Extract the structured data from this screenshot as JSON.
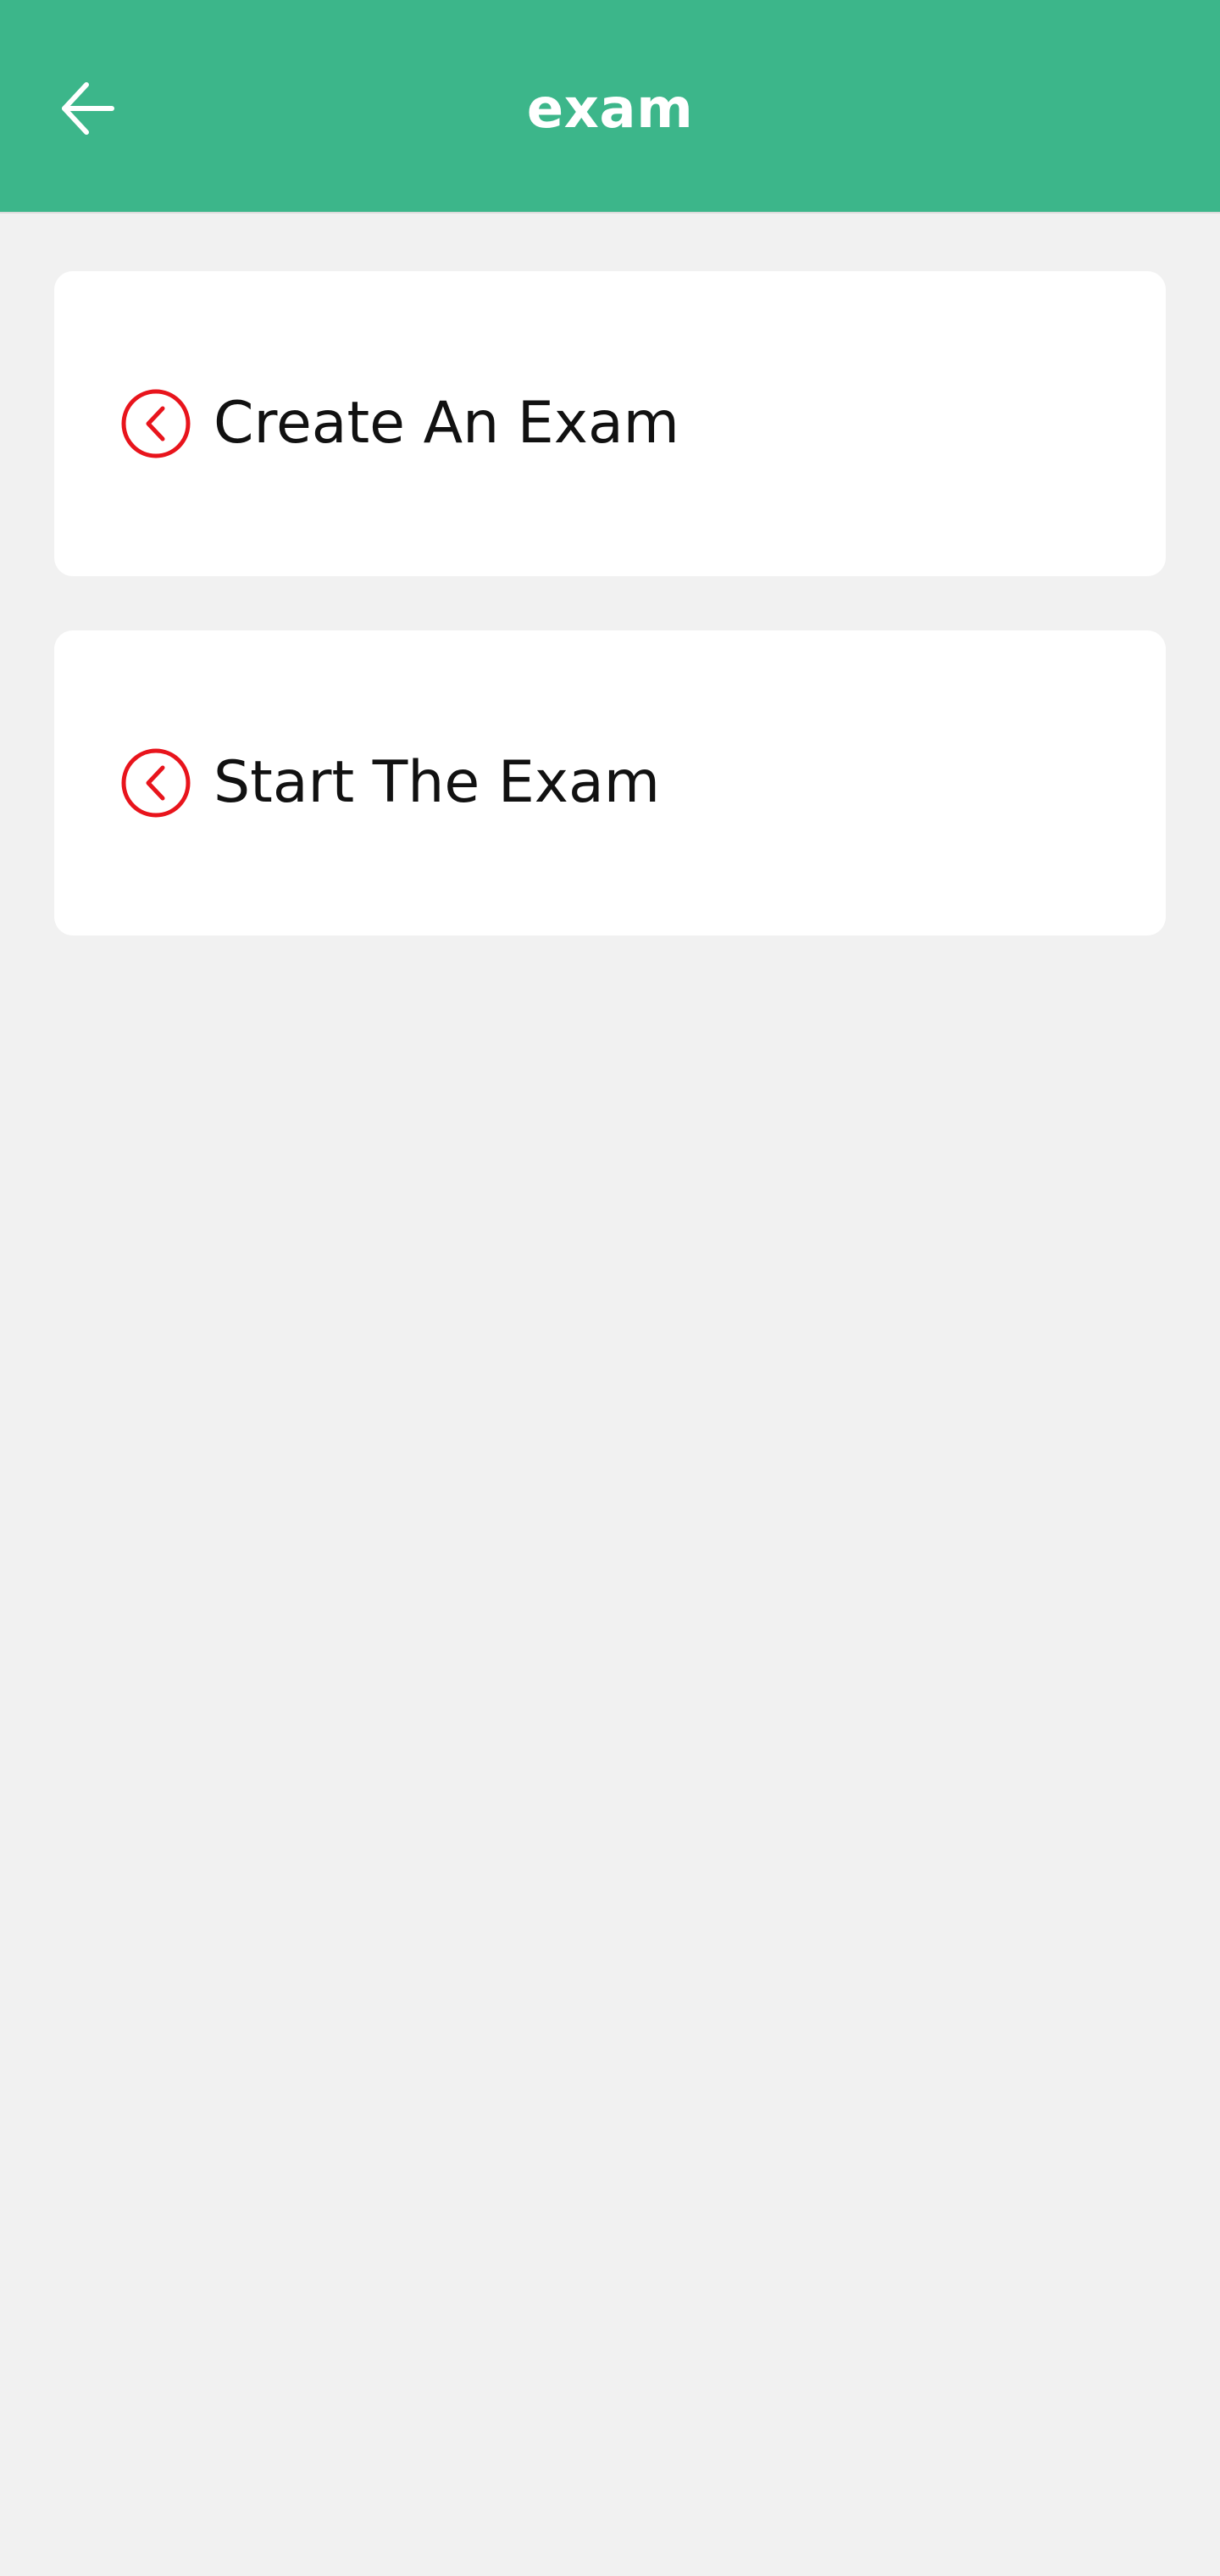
{
  "header": {
    "title": "exam",
    "back_icon": "arrow-left-icon",
    "background_color": "#3cb68a",
    "title_color": "#ffffff"
  },
  "menu": {
    "items": [
      {
        "label": "Create An Exam",
        "icon": "chevron-left-circle-icon",
        "icon_color": "#e8141c"
      },
      {
        "label": "Start The Exam",
        "icon": "chevron-left-circle-icon",
        "icon_color": "#e8141c"
      }
    ]
  },
  "colors": {
    "page_background": "#f1f1f1",
    "card_background": "#ffffff",
    "text": "#111111"
  }
}
